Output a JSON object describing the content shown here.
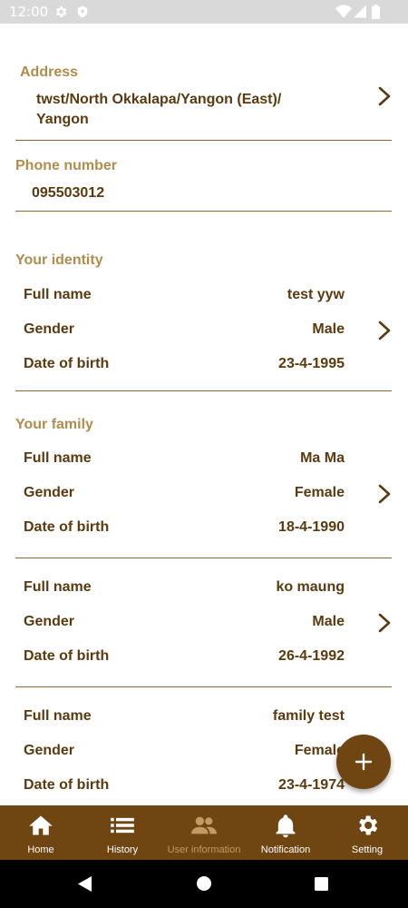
{
  "status_bar": {
    "time": "12:00",
    "icons": [
      "gear-icon",
      "shield-icon",
      "wifi-icon",
      "signal-icon",
      "battery-icon"
    ]
  },
  "address": {
    "title": "Address",
    "line1": "twst/North Okkalapa/Yangon (East)/",
    "line2": "Yangon"
  },
  "phone": {
    "title": "Phone number",
    "value": "095503012"
  },
  "identity": {
    "title": "Your identity",
    "full_name_label": "Full name",
    "full_name": "test yyw",
    "gender_label": "Gender",
    "gender": "Male",
    "dob_label": "Date of birth",
    "dob": "23-4-1995"
  },
  "family": {
    "title": "Your family",
    "members": [
      {
        "full_name_label": "Full name",
        "full_name": "Ma Ma",
        "gender_label": "Gender",
        "gender": "Female",
        "dob_label": "Date of birth",
        "dob": "18-4-1990"
      },
      {
        "full_name_label": "Full name",
        "full_name": "ko maung",
        "gender_label": "Gender",
        "gender": "Male",
        "dob_label": "Date of birth",
        "dob": "26-4-1992"
      },
      {
        "full_name_label": "Full name",
        "full_name": "family test",
        "gender_label": "Gender",
        "gender": "Female",
        "dob_label": "Date of birth",
        "dob": "23-4-1974"
      }
    ]
  },
  "fab": {
    "icon": "plus-icon"
  },
  "bottom_nav": {
    "items": [
      {
        "label": "Home",
        "icon": "home-icon",
        "active": true
      },
      {
        "label": "History",
        "icon": "list-icon",
        "active": true
      },
      {
        "label": "User information",
        "icon": "people-icon",
        "active": false
      },
      {
        "label": "Notification",
        "icon": "bell-icon",
        "active": true
      },
      {
        "label": "Setting",
        "icon": "gear-icon",
        "active": true
      }
    ]
  },
  "colors": {
    "brand_brown": "#6f4511",
    "section_title": "#b08d4c",
    "text_dark": "#5a3a0e",
    "inactive_nav": "#c49a63"
  }
}
